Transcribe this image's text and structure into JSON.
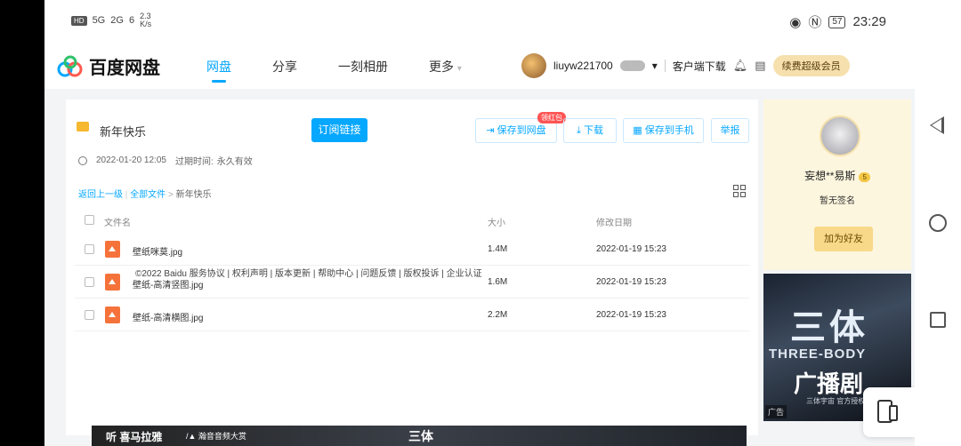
{
  "status_bar": {
    "left_chips": [
      "HD",
      "5G",
      "2G",
      "6"
    ],
    "net_speed": "2.3\nK/s",
    "right_icons": [
      "eye-icon",
      "nfc-icon"
    ],
    "battery": "57",
    "time": "23:29"
  },
  "header": {
    "logo": "百度网盘",
    "nav": [
      "网盘",
      "分享",
      "一刻相册",
      "更多"
    ],
    "username": "liuyw221700",
    "client_download": "客户端下载",
    "renew_vip": "续费超级会员"
  },
  "share": {
    "folder_title": "新年快乐",
    "subscribe_btn": "订阅链接",
    "save_to_disk": "保存到网盘",
    "red_packet": "领红包",
    "download": "下载",
    "save_to_phone": "保存到手机",
    "report": "举报",
    "created": "2022-01-20 12:05",
    "expire_label": "过期时间:",
    "expire_value": "永久有效",
    "breadcrumb": {
      "back": "返回上一级",
      "all": "全部文件",
      "sep": ">",
      "current": "新年快乐"
    },
    "columns": {
      "name": "文件名",
      "size": "大小",
      "date": "修改日期"
    },
    "files": [
      {
        "name": "壁纸咪莫.jpg",
        "size": "1.4M",
        "date": "2022-01-19 15:23"
      },
      {
        "name": "壁纸-高清竖图.jpg",
        "size": "1.6M",
        "date": "2022-01-19 15:23"
      },
      {
        "name": "壁纸-高清横图.jpg",
        "size": "2.2M",
        "date": "2022-01-19 15:23"
      }
    ],
    "footer_links": "©2022 Baidu  服务协议 | 权利声明 | 版本更新 | 帮助中心 | 问题反馈 | 版权投诉 | 企业认证"
  },
  "sharer": {
    "name": "妄想**易斯",
    "level": "5",
    "signature": "暂无签名",
    "add_friend": "加为好友"
  },
  "ad": {
    "title": "三体",
    "subtitle": "THREE-BODY",
    "subtitle2": "广播剧",
    "small": "三体宇宙 官方授权",
    "tag": "广告"
  },
  "bottom_ad": {
    "logo": "听 喜马拉雅",
    "partner": "/▲ 瀚音音频大赏",
    "title": "三体"
  }
}
